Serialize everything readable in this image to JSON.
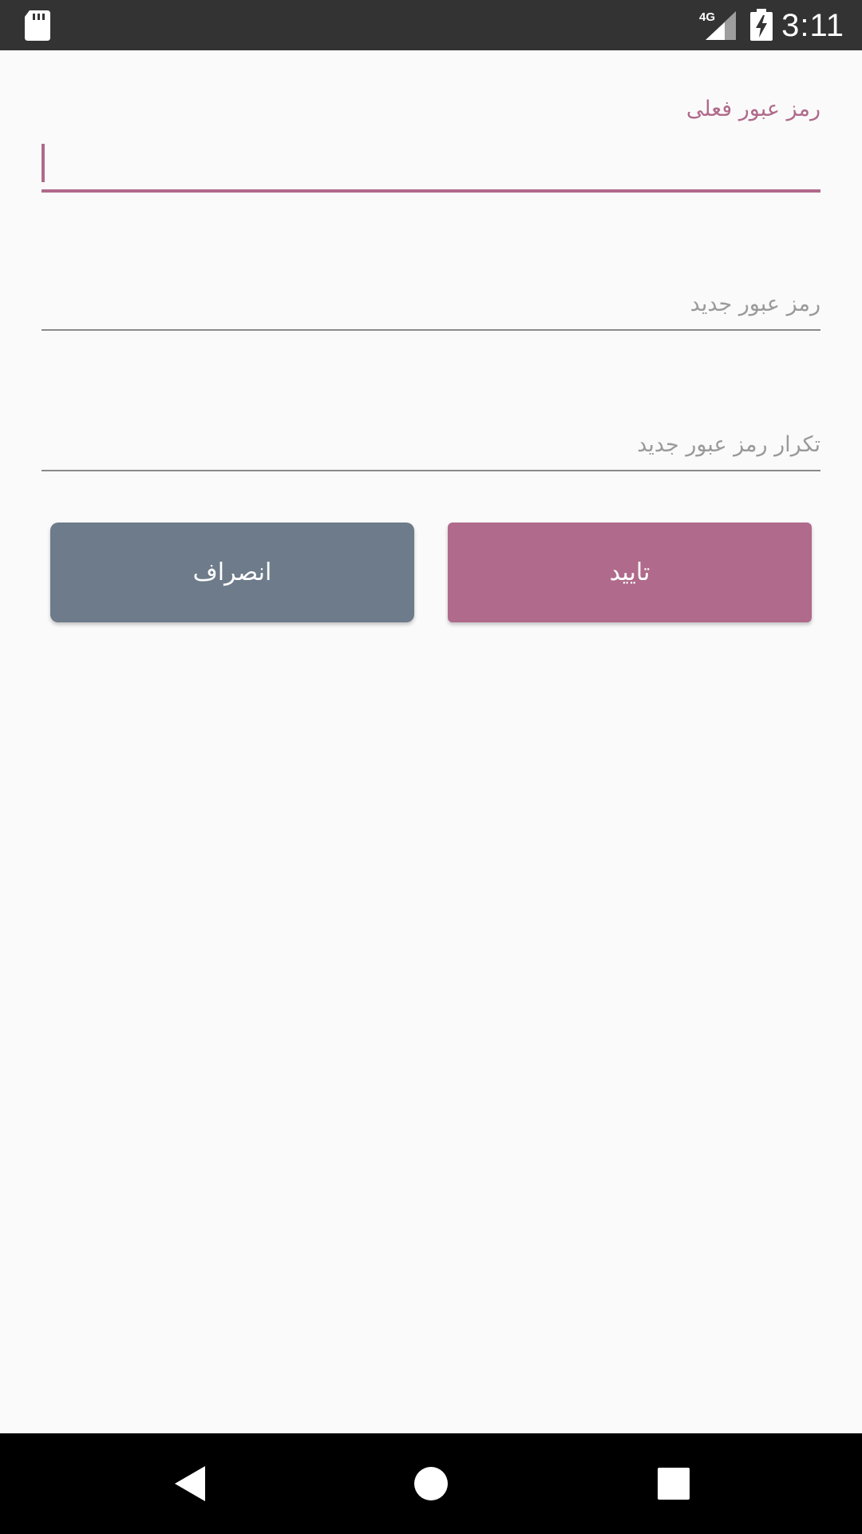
{
  "status_bar": {
    "time": "3:11",
    "network_type": "4G",
    "icons": [
      "sd-card-icon",
      "cellular-signal-icon",
      "battery-charging-icon"
    ]
  },
  "form": {
    "current_password": {
      "label": "رمز عبور فعلی",
      "value": ""
    },
    "new_password": {
      "placeholder": "رمز عبور جدید",
      "value": ""
    },
    "confirm_password": {
      "placeholder": "تکرار رمز عبور جدید",
      "value": ""
    }
  },
  "buttons": {
    "cancel_label": "انصراف",
    "confirm_label": "تایید"
  },
  "nav_bar": {
    "icons": [
      "back-icon",
      "home-icon",
      "recents-icon"
    ]
  },
  "colors": {
    "accent": "#b06a8b",
    "cancel_button": "#6d7b8a",
    "status_bar": "#333333",
    "background": "#fafafa",
    "nav_bar": "#000000"
  }
}
